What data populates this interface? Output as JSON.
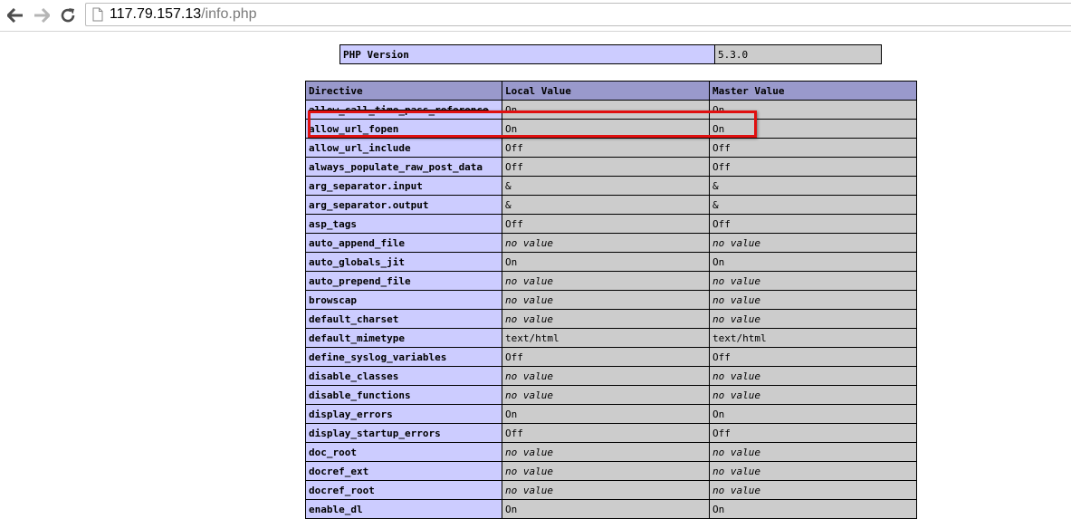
{
  "browser": {
    "url_host": "117.79.157.13",
    "url_path": "/info.php",
    "icons": [
      "back-arrow-icon",
      "forward-arrow-icon",
      "reload-icon",
      "page-icon"
    ]
  },
  "version": {
    "label": "PHP Version",
    "value": "5.3.0"
  },
  "directives": {
    "headers": [
      "Directive",
      "Local Value",
      "Master Value"
    ],
    "rows": [
      {
        "name": "allow_call_time_pass_reference",
        "local": "On",
        "master": "On",
        "local_italic": false
      },
      {
        "name": "allow_url_fopen",
        "local": "On",
        "master": "On",
        "local_italic": false
      },
      {
        "name": "allow_url_include",
        "local": "Off",
        "master": "Off",
        "local_italic": false
      },
      {
        "name": "always_populate_raw_post_data",
        "local": "Off",
        "master": "Off",
        "local_italic": false
      },
      {
        "name": "arg_separator.input",
        "local": "&",
        "master": "&",
        "local_italic": false
      },
      {
        "name": "arg_separator.output",
        "local": "&",
        "master": "&",
        "local_italic": false
      },
      {
        "name": "asp_tags",
        "local": "Off",
        "master": "Off",
        "local_italic": false
      },
      {
        "name": "auto_append_file",
        "local": "no value",
        "master": "no value",
        "local_italic": true
      },
      {
        "name": "auto_globals_jit",
        "local": "On",
        "master": "On",
        "local_italic": false
      },
      {
        "name": "auto_prepend_file",
        "local": "no value",
        "master": "no value",
        "local_italic": true
      },
      {
        "name": "browscap",
        "local": "no value",
        "master": "no value",
        "local_italic": true
      },
      {
        "name": "default_charset",
        "local": "no value",
        "master": "no value",
        "local_italic": true
      },
      {
        "name": "default_mimetype",
        "local": "text/html",
        "master": "text/html",
        "local_italic": false
      },
      {
        "name": "define_syslog_variables",
        "local": "Off",
        "master": "Off",
        "local_italic": false
      },
      {
        "name": "disable_classes",
        "local": "no value",
        "master": "no value",
        "local_italic": true
      },
      {
        "name": "disable_functions",
        "local": "no value",
        "master": "no value",
        "local_italic": true
      },
      {
        "name": "display_errors",
        "local": "On",
        "master": "On",
        "local_italic": false
      },
      {
        "name": "display_startup_errors",
        "local": "Off",
        "master": "Off",
        "local_italic": false
      },
      {
        "name": "doc_root",
        "local": "no value",
        "master": "no value",
        "local_italic": true
      },
      {
        "name": "docref_ext",
        "local": "no value",
        "master": "no value",
        "local_italic": true
      },
      {
        "name": "docref_root",
        "local": "no value",
        "master": "no value",
        "local_italic": true
      },
      {
        "name": "enable_dl",
        "local": "On",
        "master": "On",
        "local_italic": false
      }
    ]
  },
  "highlight": {
    "color": "#e01010",
    "row": "allow_url_fopen"
  },
  "colors": {
    "header_bg": "#9999cc",
    "name_bg": "#ccccff",
    "value_bg": "#cccccc"
  }
}
